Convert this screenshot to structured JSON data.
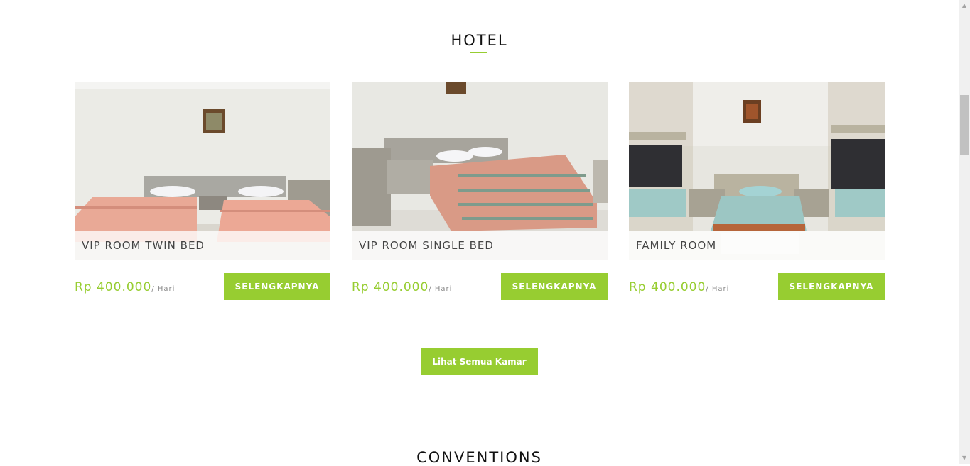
{
  "hotel_section": {
    "title": "HOTEL",
    "rooms": [
      {
        "name": "VIP ROOM TWIN BED",
        "price": "Rp 400.000",
        "unit": "/ Hari",
        "button": "SELENGKAPNYA",
        "photo": "twin-bed-room-photo"
      },
      {
        "name": "VIP ROOM SINGLE BED",
        "price": "Rp 400.000",
        "unit": "/ Hari",
        "button": "SELENGKAPNYA",
        "photo": "single-bed-room-photo"
      },
      {
        "name": "FAMILY ROOM",
        "price": "Rp 400.000",
        "unit": "/ Hari",
        "button": "SELENGKAPNYA",
        "photo": "family-room-photo"
      }
    ],
    "view_all_button": "Lihat Semua Kamar"
  },
  "conventions_section": {
    "title": "CONVENTIONS"
  },
  "colors": {
    "accent": "#97cd31",
    "title": "#111111",
    "caption_text": "#444444"
  },
  "scrollbar": {
    "up_icon": "scroll-up-arrow-icon",
    "down_icon": "scroll-down-arrow-icon"
  }
}
